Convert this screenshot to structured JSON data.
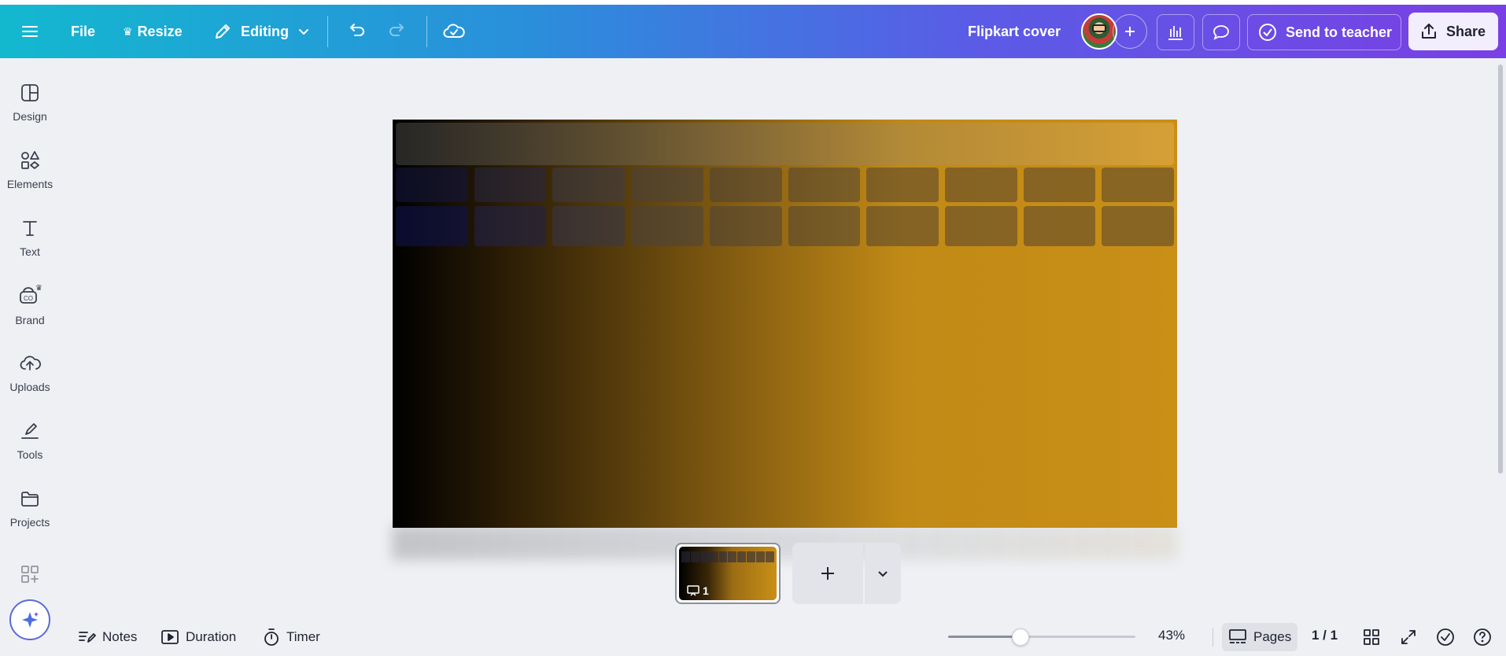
{
  "header": {
    "menu_icon": "hamburger-menu-icon",
    "file_label": "File",
    "resize_label": "Resize",
    "editing_label": "Editing",
    "doc_title": "Flipkart cover",
    "send_label": "Send to teacher",
    "share_label": "Share"
  },
  "sidebar": {
    "items": [
      {
        "label": "Design",
        "icon": "design-layout-icon"
      },
      {
        "label": "Elements",
        "icon": "shapes-icon"
      },
      {
        "label": "Text",
        "icon": "text-icon"
      },
      {
        "label": "Brand",
        "icon": "brand-icon"
      },
      {
        "label": "Uploads",
        "icon": "cloud-upload-icon"
      },
      {
        "label": "Tools",
        "icon": "pen-tool-icon"
      },
      {
        "label": "Projects",
        "icon": "folder-icon"
      }
    ]
  },
  "canvas": {
    "gradient_start": "#000000",
    "gradient_end": "#c98f17"
  },
  "pages": {
    "thumb_number": "1"
  },
  "footer": {
    "notes_label": "Notes",
    "duration_label": "Duration",
    "timer_label": "Timer",
    "zoom_percent": 43,
    "zoom_label": "43%",
    "pages_label": "Pages",
    "page_count": "1 / 1"
  }
}
